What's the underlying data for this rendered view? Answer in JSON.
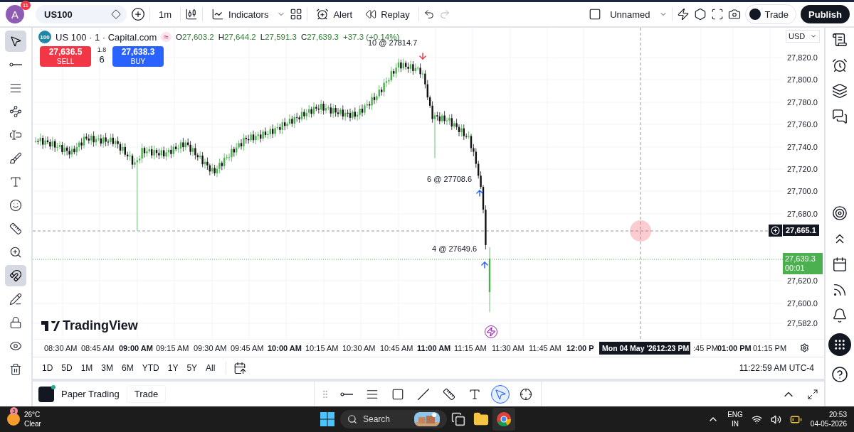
{
  "header": {
    "avatar": "A",
    "notifications": "11",
    "symbol": "US100",
    "interval": "1m",
    "indicators": "Indicators",
    "alert": "Alert",
    "replay": "Replay",
    "layout_name": "Unnamed",
    "trade": "Trade",
    "publish": "Publish"
  },
  "drawing_tools": [
    {
      "selected": true
    },
    {
      "selected": false
    },
    {
      "selected": false
    },
    {
      "selected": false
    },
    {
      "selected": false
    },
    {
      "selected": false
    },
    {
      "selected": false
    },
    {
      "selected": false
    },
    {
      "selected": false
    },
    {
      "selected": false
    },
    {
      "selected": true
    },
    {
      "selected": false
    },
    {
      "selected": false
    },
    {
      "selected": false
    },
    {
      "selected": false
    }
  ],
  "legend": {
    "badge": "100",
    "title": "US 100 · 1 · Capital.com",
    "sign": "≈",
    "ohlc": [
      {
        "label": "O",
        "value": "27,603.2"
      },
      {
        "label": "H",
        "value": "27,644.2"
      },
      {
        "label": "L",
        "value": "27,591.3"
      },
      {
        "label": "C",
        "value": "27,639.3"
      }
    ],
    "change": "+37.3 (+0.14%)"
  },
  "order_panel": {
    "sell_price": "27,636.5",
    "sell": "SELL",
    "spread": "1.8",
    "quantity": "6",
    "buy_price": "27,638.3",
    "buy": "BUY"
  },
  "trade_markers": [
    {
      "kind": "sell",
      "label": "10 @ 27814.7"
    },
    {
      "kind": "buy",
      "label": "6 @ 27708.6"
    },
    {
      "kind": "buy",
      "label": "4 @ 27649.6"
    }
  ],
  "watermark_logo": "TradingView",
  "price_axis": {
    "currency": "USD",
    "labels": [
      "27,820.0",
      "27,800.0",
      "27,780.0",
      "27,760.0",
      "27,740.0",
      "27,720.0",
      "27,700.0",
      "27,680.0",
      "27,620.0",
      "27,600.0",
      "27,582.0"
    ],
    "crosshair_price": "27,665.1",
    "last_price": "27,639.3",
    "countdown": "00:01"
  },
  "time_axis": {
    "labels": [
      {
        "text": "08:30 AM",
        "major": false
      },
      {
        "text": "08:45 AM",
        "major": false
      },
      {
        "text": "09:00 AM",
        "major": true
      },
      {
        "text": "09:15 AM",
        "major": false
      },
      {
        "text": "09:30 AM",
        "major": false
      },
      {
        "text": "09:45 AM",
        "major": false
      },
      {
        "text": "10:00 AM",
        "major": true
      },
      {
        "text": "10:15 AM",
        "major": false
      },
      {
        "text": "10:30 AM",
        "major": false
      },
      {
        "text": "10:45 AM",
        "major": false
      },
      {
        "text": "11:00 AM",
        "major": true
      },
      {
        "text": "11:15 AM",
        "major": false
      },
      {
        "text": "11:30 AM",
        "major": false
      },
      {
        "text": "11:45 AM",
        "major": false
      },
      {
        "text": "12:00 P",
        "major": true
      },
      {
        "text": ":45 PM",
        "major": false
      },
      {
        "text": "01:00 PM",
        "major": true
      },
      {
        "text": "01:15 PM",
        "major": false
      }
    ],
    "crosshair_date": "Mon 04 May '26",
    "crosshair_time": "12:23 PM"
  },
  "ranges": [
    {
      "label": "1D",
      "selected": false
    },
    {
      "label": "5D",
      "selected": false
    },
    {
      "label": "1M",
      "selected": false
    },
    {
      "label": "3M",
      "selected": false
    },
    {
      "label": "6M",
      "selected": false
    },
    {
      "label": "YTD",
      "selected": false
    },
    {
      "label": "1Y",
      "selected": false
    },
    {
      "label": "5Y",
      "selected": false
    },
    {
      "label": "All",
      "selected": false
    }
  ],
  "clock": "11:22:59 AM UTC-4",
  "bottom_panel": {
    "tabs": [
      {
        "label": "Paper Trading",
        "selected": false
      },
      {
        "label": "Trade",
        "selected": false
      }
    ]
  },
  "floating_tools": [
    {
      "selected": false
    },
    {
      "selected": false
    },
    {
      "selected": false
    },
    {
      "selected": false
    },
    {
      "selected": false
    },
    {
      "selected": false
    },
    {
      "selected": true
    },
    {
      "selected": false
    }
  ],
  "taskbar": {
    "weather_badge": "3",
    "temperature": "26°C",
    "condition": "Clear",
    "search": "Search",
    "language": "ENG",
    "region": "IN",
    "time": "20:53",
    "date": "04-05-2026"
  }
}
